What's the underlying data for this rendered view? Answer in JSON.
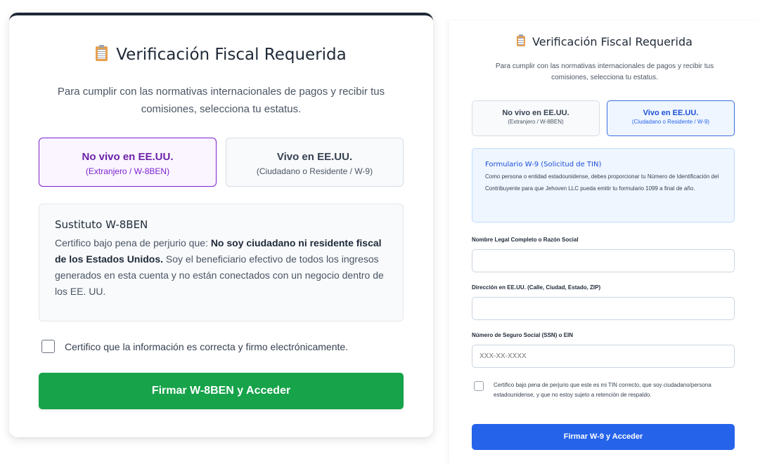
{
  "w8ben": {
    "title": "Verificación Fiscal Requerida",
    "subtitle": "Para cumplir con las normativas internacionales de pagos y recibir tus comisiones, selecciona tu estatus.",
    "options": [
      {
        "title": "No vivo en EE.UU.",
        "subtitle": "(Extranjero / W-8BEN)",
        "selected": true
      },
      {
        "title": "Vivo en EE.UU.",
        "subtitle": "(Ciudadano o Residente / W-9)",
        "selected": false
      }
    ],
    "declaration": {
      "title": "Sustituto W-8BEN",
      "text_before": "Certifico bajo pena de perjurio que: ",
      "text_bold": "No soy ciudadano ni residente fiscal de los Estados Unidos.",
      "text_after": " Soy el beneficiario efectivo de todos los ingresos generados en esta cuenta y no están conectados con un negocio dentro de los EE. UU."
    },
    "checkbox_label": "Certifico que la información es correcta y firmo electrónicamente.",
    "submit_label": "Firmar W-8BEN y Acceder"
  },
  "w9": {
    "title": "Verificación Fiscal Requerida",
    "subtitle": "Para cumplir con las normativas internacionales de pagos y recibir tus comisiones, selecciona tu estatus.",
    "options": [
      {
        "title": "No vivo en EE.UU.",
        "subtitle": "(Extranjero / W-8BEN)",
        "selected": false
      },
      {
        "title": "Vivo en EE.UU.",
        "subtitle": "(Ciudadano o Residente / W-9)",
        "selected": true
      }
    ],
    "info": {
      "title": "Formulario W-9 (Solicitud de TIN)",
      "text": "Como persona o entidad estadounidense, debes proporcionar tu Número de Identificación del Contribuyente para que Jehoven LLC pueda emitir tu formulario 1099 a final de año."
    },
    "fields": {
      "name_label": "Nombre Legal Completo o Razón Social",
      "name_value": "",
      "address_label": "Dirección en EE.UU. (Calle, Ciudad, Estado, ZIP)",
      "address_value": "",
      "tin_label": "Número de Seguro Social (SSN) o EIN",
      "tin_placeholder": "XXX-XX-XXXX"
    },
    "checkbox_label": "Certifico bajo pena de perjurio que este es mi TIN correcto, que soy ciudadano/persona estadounidense, y que no estoy sujeto a retención de respaldo.",
    "submit_label": "Firmar W-9 y Acceder"
  },
  "colors": {
    "w8_accent": "#7e22ce",
    "w8_button": "#16a34a",
    "w9_accent": "#1d4ed8",
    "w9_button": "#2563eb"
  },
  "icons": {
    "title_icon": "clipboard-icon"
  }
}
